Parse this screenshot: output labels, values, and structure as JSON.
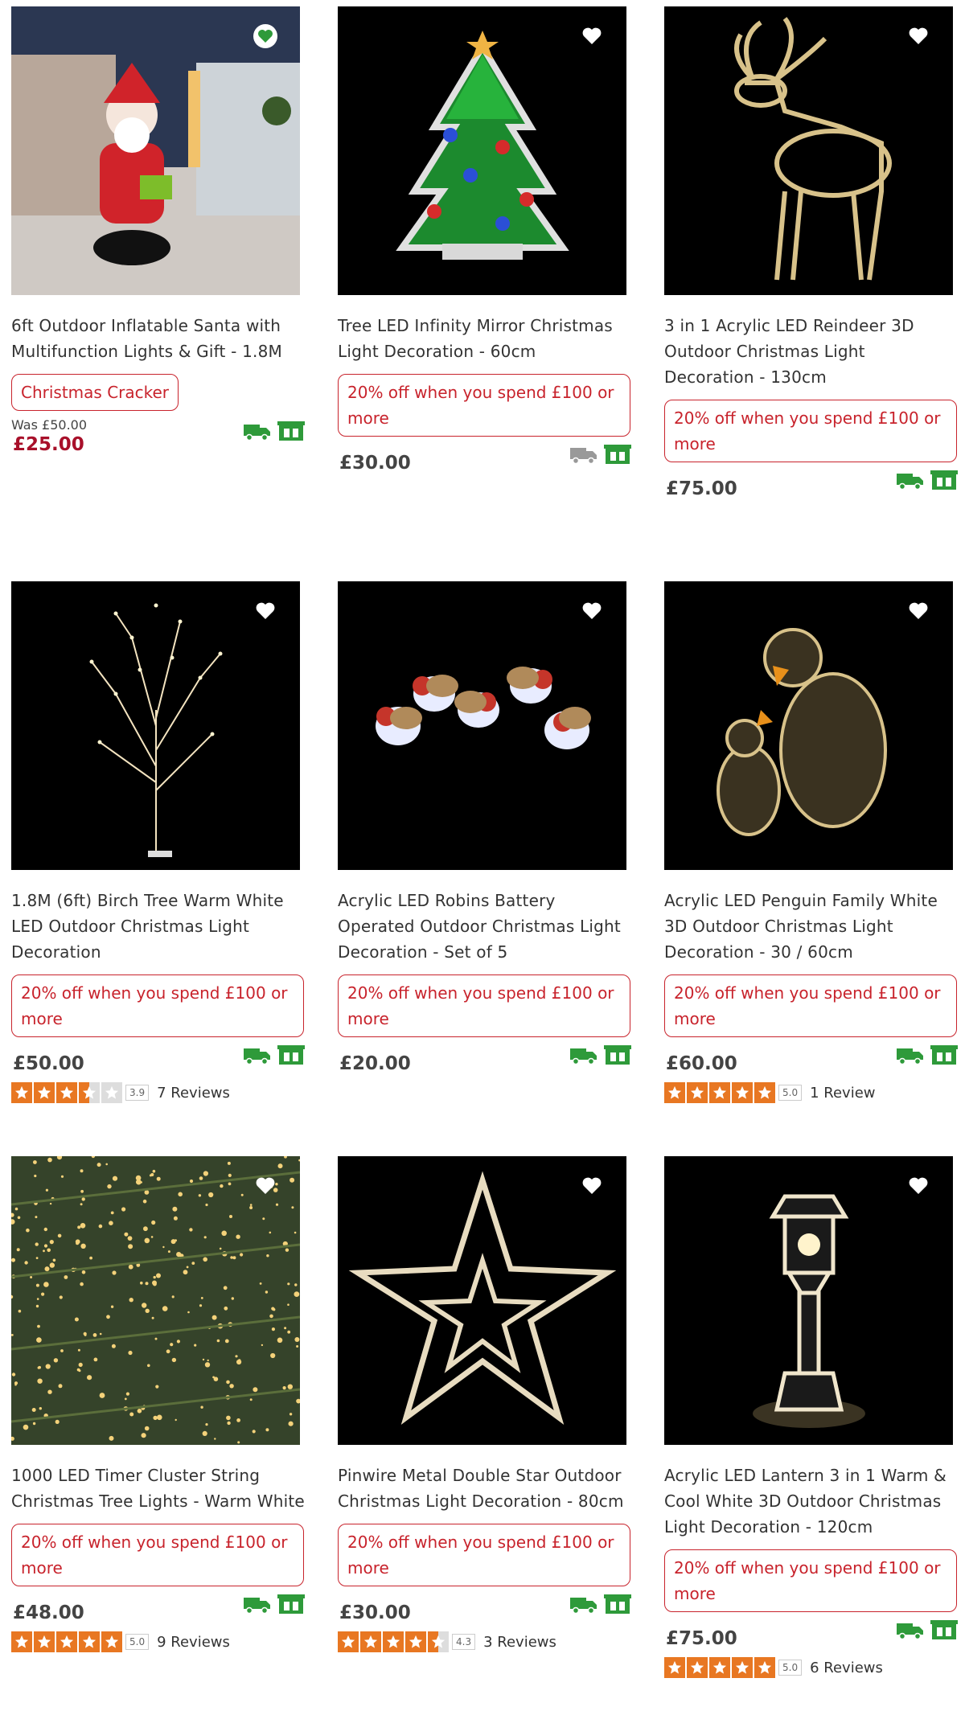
{
  "products": [
    {
      "title": "6ft Outdoor Inflatable Santa with Multifunction Lights & Gift - 1.8M",
      "promo": "Christmas Cracker",
      "was": "Was £50.00",
      "price": "£25.00"
    },
    {
      "title": "Tree LED Infinity Mirror Christmas Light Decoration - 60cm",
      "promo": "20% off when you spend £100 or more",
      "price": "£30.00"
    },
    {
      "title": "3 in 1 Acrylic LED Reindeer 3D Outdoor Christmas Light Decoration - 130cm",
      "promo": "20% off when you spend £100 or more",
      "price": "£75.00"
    },
    {
      "title": "1.8M (6ft) Birch Tree Warm White LED Outdoor Christmas Light Decoration",
      "promo": "20% off when you spend £100 or more",
      "price": "£50.00",
      "rating": 3.9,
      "score": "3.9",
      "reviews": "7 Reviews"
    },
    {
      "title": "Acrylic LED Robins Battery Operated Outdoor Christmas Light Decoration - Set of 5",
      "promo": "20% off when you spend £100 or more",
      "price": "£20.00"
    },
    {
      "title": "Acrylic LED Penguin Family White 3D Outdoor Christmas Light Decoration - 30 / 60cm",
      "promo": "20% off when you spend £100 or more",
      "price": "£60.00",
      "rating": 5.0,
      "score": "5.0",
      "reviews": "1 Review"
    },
    {
      "title": "1000 LED Timer Cluster String Christmas Tree Lights - Warm White",
      "promo": "20% off when you spend £100 or more",
      "price": "£48.00",
      "rating": 5.0,
      "score": "5.0",
      "reviews": "9 Reviews"
    },
    {
      "title": "Pinwire Metal Double Star Outdoor Christmas Light Decoration - 80cm",
      "promo": "20% off when you spend £100 or more",
      "price": "£30.00",
      "rating": 4.3,
      "score": "4.3",
      "reviews": "3 Reviews"
    },
    {
      "title": "Acrylic LED Lantern 3 in 1 Warm & Cool White 3D Outdoor Christmas Light Decoration - 120cm",
      "promo": "20% off when you spend £100 or more",
      "price": "£75.00",
      "rating": 5.0,
      "score": "5.0",
      "reviews": "6 Reviews"
    }
  ],
  "colors": {
    "accent_red": "#c8232c",
    "sale_red": "#a8102a",
    "delivery_green": "#2e9a3a",
    "star_orange": "#e87722"
  }
}
